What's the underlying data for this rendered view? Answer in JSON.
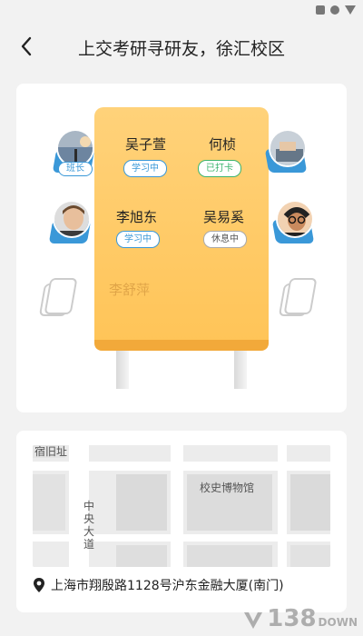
{
  "header": {
    "title": "上交考研寻研友，徐汇校区"
  },
  "table": {
    "seats": [
      {
        "name": "吴子萱",
        "status": "学习中",
        "status_color": "#3a98d8"
      },
      {
        "name": "何桢",
        "status": "已打卡",
        "status_color": "#3cb46e"
      },
      {
        "name": "李旭东",
        "status": "学习中",
        "status_color": "#3a98d8"
      },
      {
        "name": "吴易奚",
        "status": "休息中",
        "status_color": "#555555"
      },
      {
        "name": "李舒萍"
      }
    ],
    "avatar_tag": "班长"
  },
  "map": {
    "labels": [
      "宿旧址",
      "校史博物馆",
      "中央大道"
    ],
    "address": "上海市翔殷路1128号沪东金融大厦(南门)"
  },
  "watermark": {
    "number": "138",
    "suffix": "DOWN"
  },
  "colors": {
    "accent": "#3a98d8",
    "table": "#ffc457",
    "green": "#3cb46e"
  }
}
